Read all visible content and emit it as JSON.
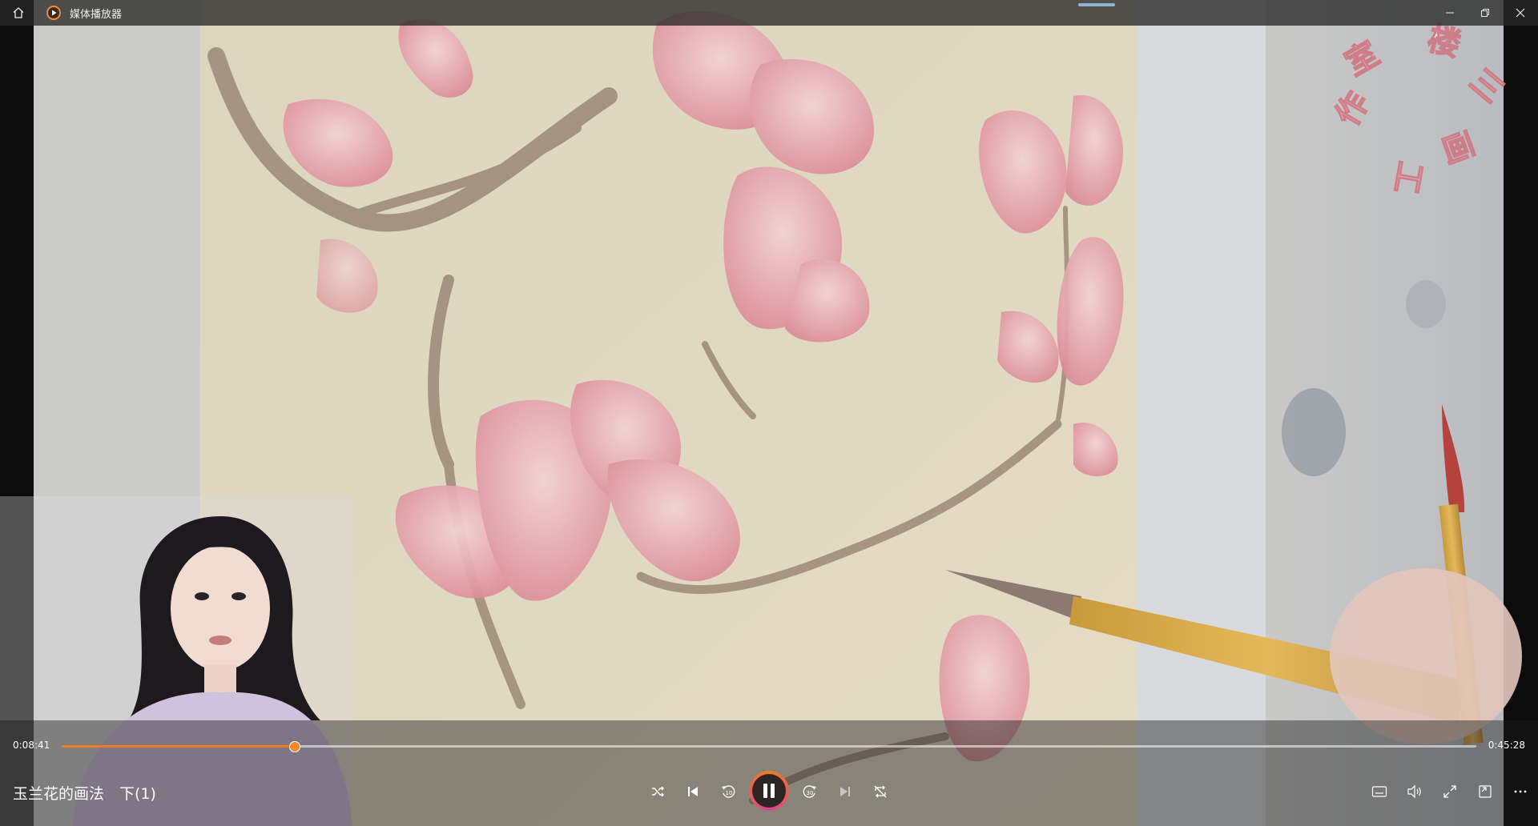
{
  "window": {
    "app_title": "媒体播放器"
  },
  "player": {
    "current_time": "0:08:41",
    "total_time": "0:45:28",
    "progress_fraction": 0.164,
    "media_title": "玉兰花的画法　下(1)",
    "state": "playing"
  },
  "video": {
    "watermark_text": "楼三画工作室"
  },
  "colors": {
    "accent": "#f07c22",
    "titlebar": "#2a2a2a"
  },
  "icons": {
    "titlebar": [
      "home-icon",
      "media-player-app-icon",
      "minimize-icon",
      "restore-icon",
      "close-icon"
    ],
    "transport": [
      "shuffle-icon",
      "previous-icon",
      "rewind-10-icon",
      "pause-icon",
      "forward-30-icon",
      "next-icon",
      "repeat-off-icon"
    ],
    "right": [
      "captions-icon",
      "volume-icon",
      "fullscreen-icon",
      "mini-player-icon",
      "more-icon"
    ]
  }
}
